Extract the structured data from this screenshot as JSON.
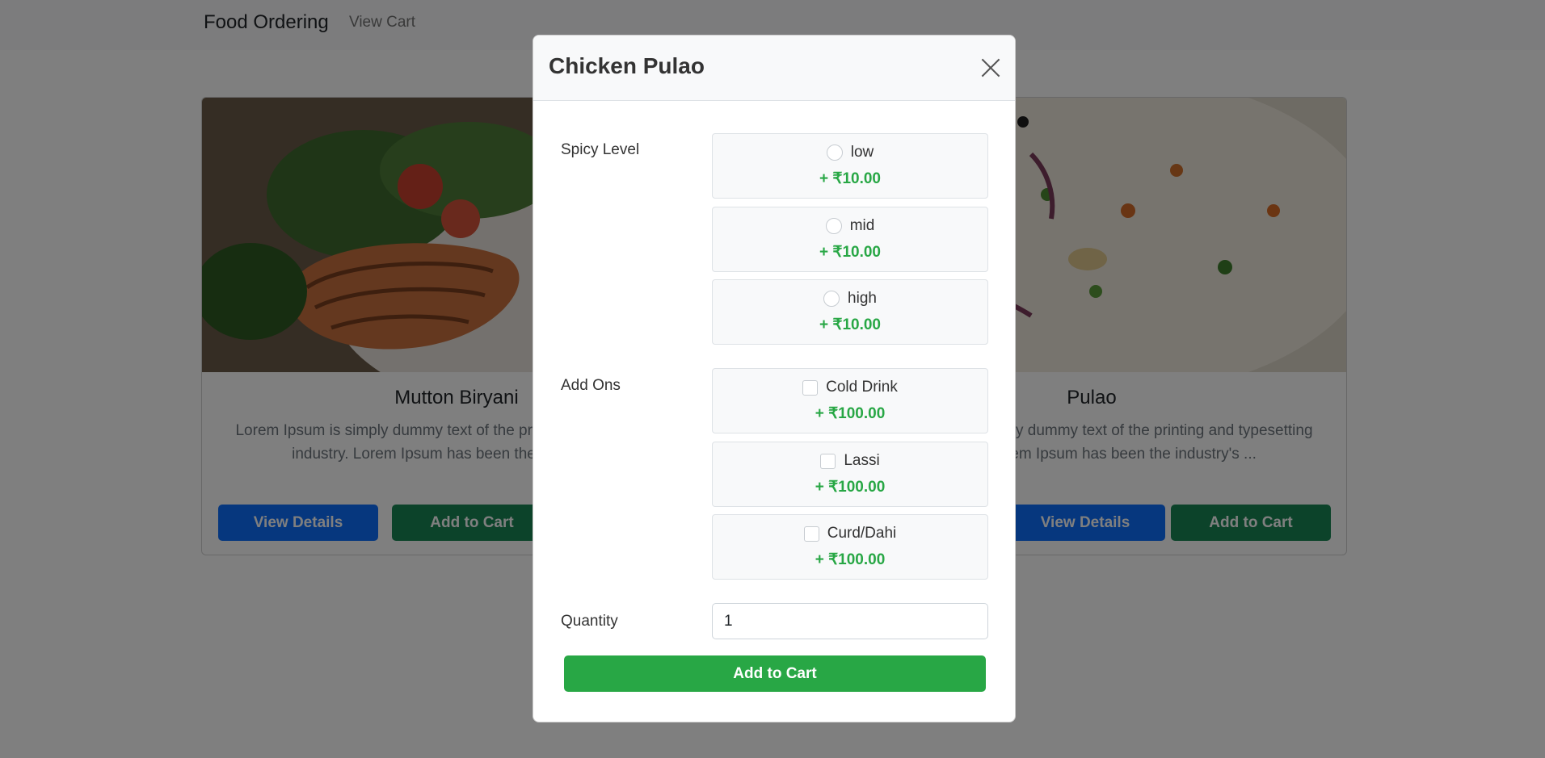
{
  "navbar": {
    "brand": "Food Ordering",
    "view_cart": "View Cart"
  },
  "cards": [
    {
      "title": "Mutton Biryani",
      "text": "Lorem Ipsum is simply dummy text of the printing and typesetting industry. Lorem Ipsum has been the industry's ...",
      "details_label": "View Details",
      "cart_label": "Add to Cart"
    },
    {
      "title": "Pulao",
      "text": "Lorem Ipsum is simply dummy text of the printing and typesetting industry. Lorem Ipsum has been the industry's ...",
      "details_label": "View Details",
      "cart_label": "Add to Cart"
    }
  ],
  "modal": {
    "title": "Chicken Pulao",
    "spicy_label": "Spicy Level",
    "spicy_options": [
      {
        "label": "low",
        "price": "+ ₹10.00"
      },
      {
        "label": "mid",
        "price": "+ ₹10.00"
      },
      {
        "label": "high",
        "price": "+ ₹10.00"
      }
    ],
    "addons_label": "Add Ons",
    "addons": [
      {
        "label": "Cold Drink",
        "price": "+ ₹100.00"
      },
      {
        "label": "Lassi",
        "price": "+ ₹100.00"
      },
      {
        "label": "Curd/Dahi",
        "price": "+ ₹100.00"
      }
    ],
    "quantity_label": "Quantity",
    "quantity_value": "1",
    "submit_label": "Add to Cart"
  },
  "colors": {
    "primary": "#0d6efd",
    "success": "#198754",
    "price_green": "#28a745",
    "modal_button": "#28a745"
  }
}
